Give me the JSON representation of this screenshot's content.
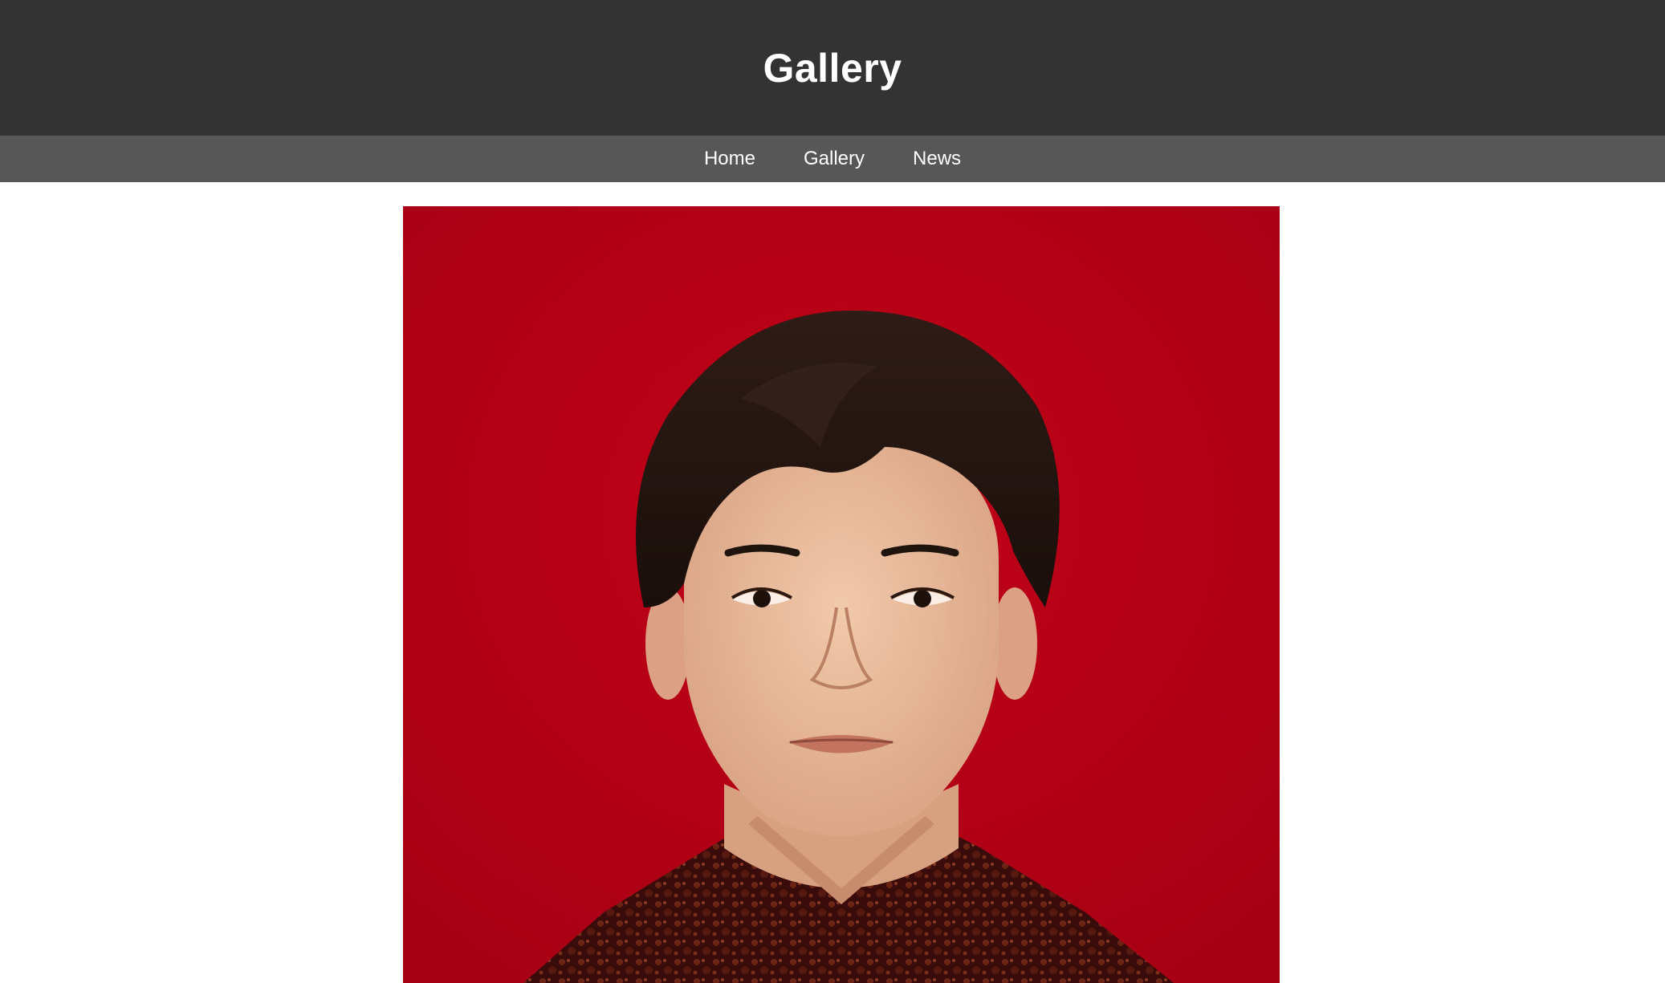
{
  "header": {
    "title": "Gallery"
  },
  "nav": {
    "items": [
      {
        "label": "Home"
      },
      {
        "label": "Gallery"
      },
      {
        "label": "News"
      }
    ]
  },
  "main": {
    "photo": {
      "subject": "portrait",
      "background_color": "#b00016"
    }
  },
  "colors": {
    "header_bg": "#333333",
    "nav_bg": "#575757",
    "text": "#ffffff"
  }
}
